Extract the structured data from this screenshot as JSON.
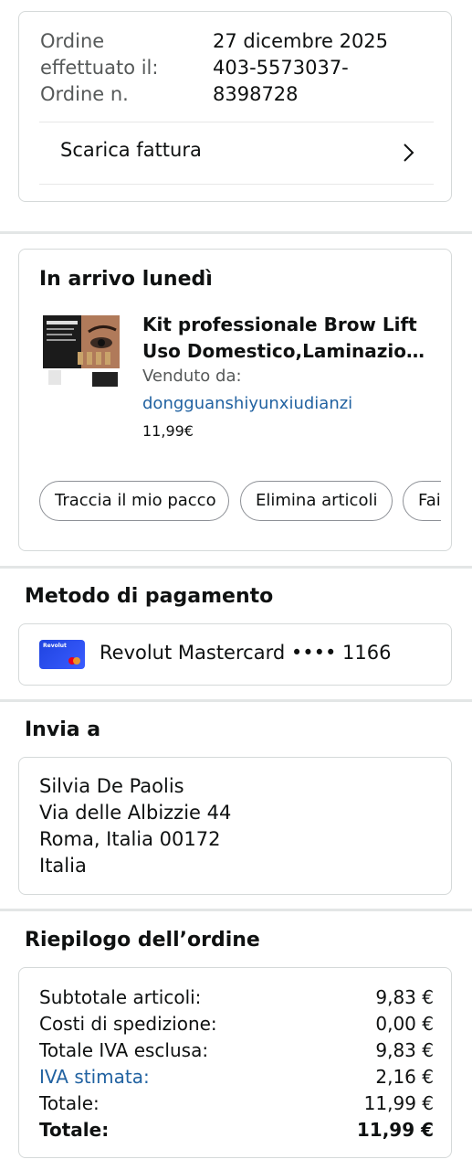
{
  "order_info": {
    "date_label": "Ordine\neffettuato il:",
    "date_label_line1": "Ordine",
    "date_label_line2": "effettuato il:",
    "number_label": "Ordine n.",
    "date_value": "27 dicembre 2025",
    "number_value_line1": "403-5573037-",
    "number_value_line2": "8398728",
    "invoice_label": "Scarica fattura"
  },
  "shipment": {
    "title": "In arrivo lunedì",
    "product_title_line1": "Kit professionale Brow Lift",
    "product_title_line2": "Uso Domestico,Laminazione Sopracciglia",
    "sold_by_label": "Venduto da:",
    "seller": "dongguanshiyunxiudianzi",
    "price": "11,99€",
    "actions": [
      {
        "label": "Traccia il mio pacco"
      },
      {
        "label": "Elimina articoli"
      },
      {
        "label": "Fai"
      }
    ]
  },
  "payment": {
    "title": "Metodo di pagamento",
    "card_brand": "Revolut",
    "card_text": "Revolut Mastercard •••• 1166"
  },
  "shipping": {
    "title": "Invia a",
    "name": "Silvia De Paolis",
    "street": "Via delle Albizzie 44",
    "city": "Roma, Italia 00172",
    "country": "Italia"
  },
  "summary": {
    "title": "Riepilogo dell’ordine",
    "rows": [
      {
        "label": "Subtotale articoli:",
        "value": "9,83 €"
      },
      {
        "label": "Costi di spedizione:",
        "value": "0,00 €"
      },
      {
        "label": "Totale IVA esclusa:",
        "value": "9,83 €"
      },
      {
        "label": "IVA stimata:",
        "value": "2,16 €"
      },
      {
        "label": "Totale:",
        "value": "11,99 €"
      },
      {
        "label": "Totale:",
        "value": "11,99 €"
      }
    ]
  },
  "colors": {
    "link": "#2162a1",
    "border": "#d5d9d9",
    "divider": "#e3e6e6",
    "card_blue": "#1f44e0"
  }
}
